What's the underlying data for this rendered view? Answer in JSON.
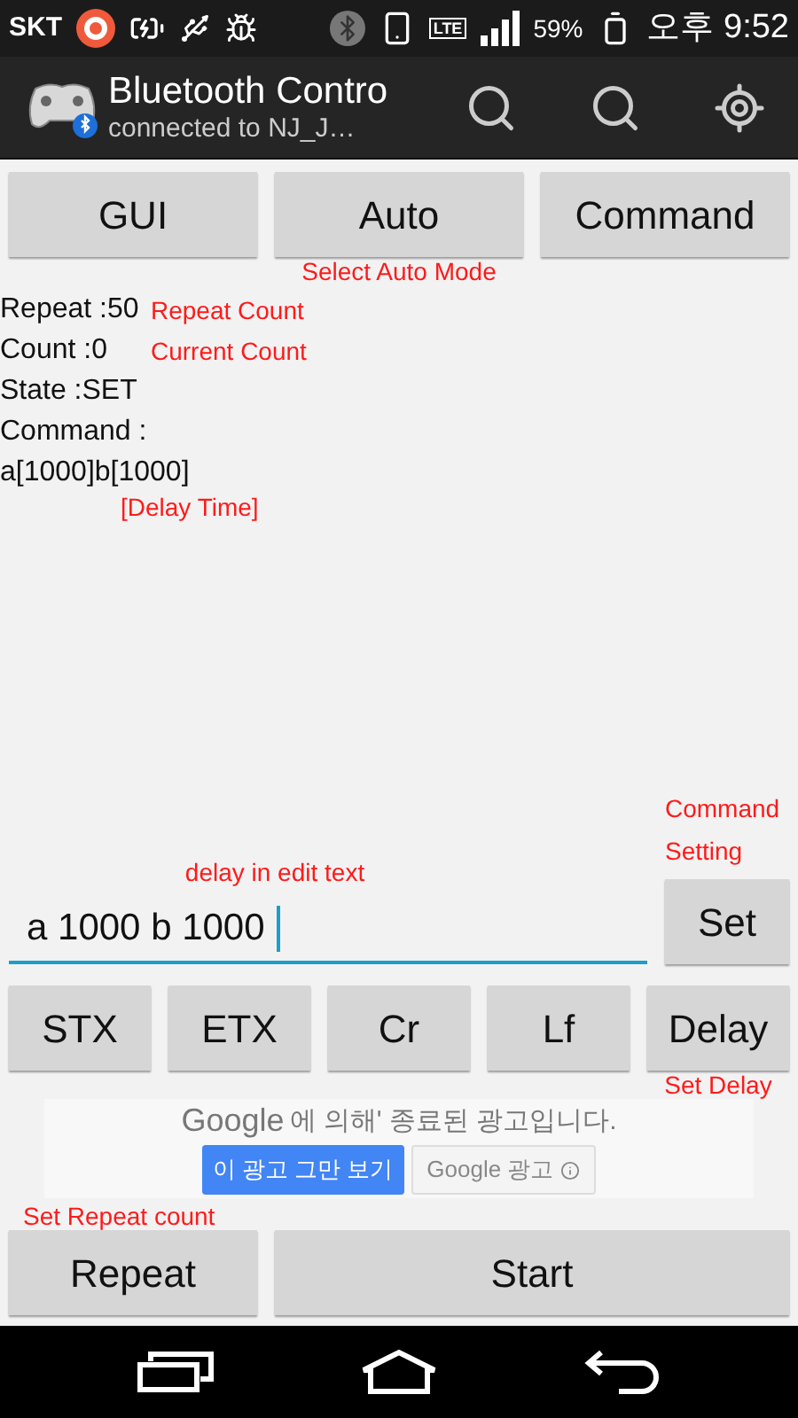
{
  "status_bar": {
    "carrier": "SKT",
    "lte": "LTE",
    "battery": "59%",
    "time": "오후 9:52"
  },
  "app_bar": {
    "title": "Bluetooth Contro",
    "subtitle": "connected to NJ_J…"
  },
  "mode_buttons": [
    {
      "label": "GUI"
    },
    {
      "label": "Auto"
    },
    {
      "label": "Command"
    }
  ],
  "mode_note": "Select Auto Mode",
  "info_lines": [
    {
      "text": "Repeat :50",
      "note": "Repeat Count"
    },
    {
      "text": "Count :0",
      "note": "Current Count"
    },
    {
      "text": "State :SET"
    },
    {
      "text": "Command :"
    },
    {
      "text": "a[1000]b[1000]"
    }
  ],
  "delay_time_note": "[Delay Time]",
  "edit_note": "delay in edit text",
  "command_notes": [
    "Command",
    "Setting"
  ],
  "command_field": {
    "value": "a 1000 b 1000"
  },
  "set_button": "Set",
  "key_buttons": [
    "STX",
    "ETX",
    "Cr",
    "Lf",
    "Delay"
  ],
  "delay_note": "Set Delay",
  "ad": {
    "logo": "Google",
    "message": "에 의해' 종료된 광고입니다.",
    "stop_button": "이 광고 그만 보기",
    "ads_button": "Google 광고"
  },
  "repeat_note": "Set Repeat count",
  "bottom_buttons": [
    "Repeat",
    "Start"
  ]
}
